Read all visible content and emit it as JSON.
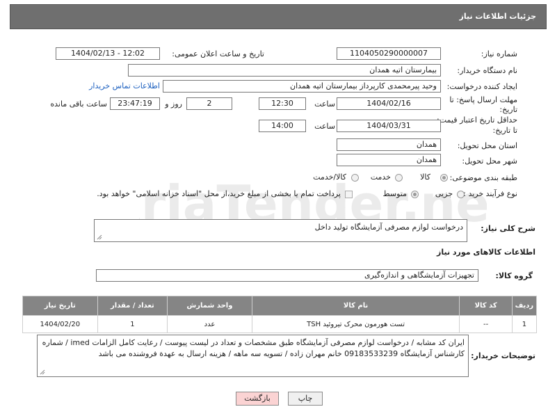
{
  "header": {
    "title": "جزئیات اطلاعات نیاز"
  },
  "form": {
    "need_number": {
      "label": "شماره نیاز:",
      "value": "1104050290000007"
    },
    "announce_datetime": {
      "label": "تاریخ و ساعت اعلان عمومی:",
      "value": "1404/02/13 - 12:02"
    },
    "buyer_org": {
      "label": "نام دستگاه خریدار:",
      "value": "بیمارستان اتیه همدان"
    },
    "requester": {
      "label": "ایجاد کننده درخواست:",
      "value": "وحید پیرمحمدی کارپرداز بیمارستان اتیه همدان",
      "contact_link": "اطلاعات تماس خریدار"
    },
    "deadline": {
      "label_line1": "مهلت ارسال پاسخ: تا",
      "label_line2": "تاریخ:",
      "date": "1404/02/16",
      "time_label": "ساعت",
      "time": "12:30",
      "days": "2",
      "days_label": "روز و",
      "remaining": "23:47:19",
      "remaining_label": "ساعت باقی مانده"
    },
    "validity": {
      "label_line1": "حداقل تاریخ اعتبار قیمت:",
      "label_line2": "تا تاریخ:",
      "date": "1404/03/31",
      "time_label": "ساعت",
      "time": "14:00"
    },
    "delivery_province": {
      "label": "استان محل تحویل:",
      "value": "همدان"
    },
    "delivery_city": {
      "label": "شهر محل تحویل:",
      "value": "همدان"
    },
    "category": {
      "label": "طبقه بندی موضوعی:",
      "options": [
        "کالا",
        "خدمت",
        "کالا/خدمت"
      ],
      "selected": "کالا"
    },
    "process": {
      "label": "نوع فرآیند خرید :",
      "options": [
        "جزیی",
        "متوسط"
      ],
      "selected": "متوسط",
      "note": "پرداخت تمام یا بخشی از مبلغ خرید،از محل \"اسناد خزانه اسلامی\" خواهد بود."
    },
    "description": {
      "label": "شرح کلی نیاز:",
      "value": "درخواست لوازم مصرفی آزمایشگاه تولید داخل"
    }
  },
  "goods": {
    "section_title": "اطلاعات کالاهای مورد نیاز",
    "group_label": "گروه کالا:",
    "group_value": "تجهیزات آزمایشگاهی و اندازه‌گیری",
    "columns": [
      "ردیف",
      "کد کالا",
      "نام کالا",
      "واحد شمارش",
      "تعداد / مقدار",
      "تاریخ نیاز"
    ],
    "rows": [
      [
        "1",
        "--",
        "تست هورمون محرک تیروئید TSH",
        "عدد",
        "1",
        "1404/02/20"
      ]
    ]
  },
  "buyer_notes": {
    "label": "توضیحات خریدار:",
    "value": "ایران کد مشابه / درخواست لوازم مصرفی آزمایشگاه طبق مشخصات و تعداد در لیست پیوست / رعایت کامل الزامات imed / شماره کارشناس آزمایشگاه 09183533239 خانم مهران زاده / تسویه سه ماهه / هزینه ارسال به عهدة فروشنده می باشد"
  },
  "buttons": {
    "print": "چاپ",
    "back": "بازگشت"
  },
  "watermark": {
    "text": "AriaTender.neT"
  }
}
